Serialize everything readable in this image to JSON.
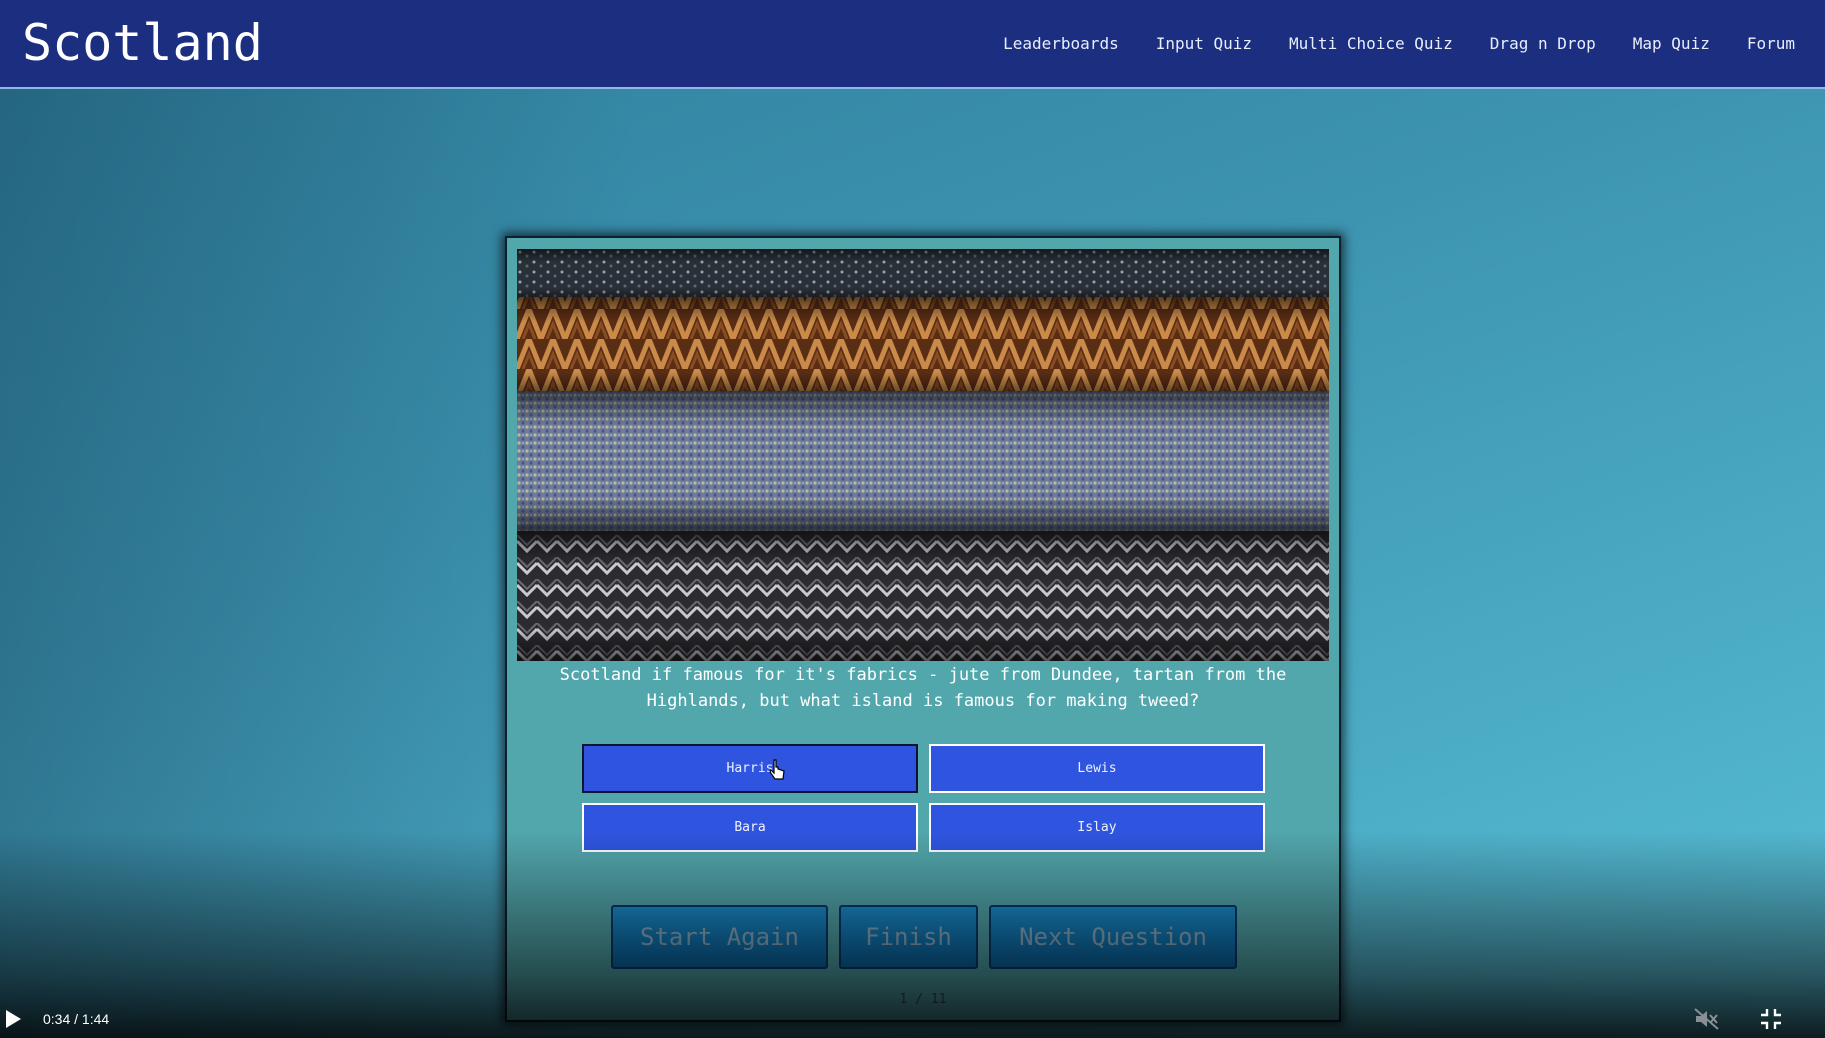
{
  "header": {
    "title": "Scotland",
    "nav": [
      "Leaderboards",
      "Input Quiz",
      "Multi Choice Quiz",
      "Drag n Drop",
      "Map Quiz",
      "Forum"
    ]
  },
  "quiz": {
    "image_alt": "stacked tweed fabrics",
    "question": "Scotland if famous for it's fabrics - jute from Dundee, tartan from the Highlands, but what island is famous for making tweed?",
    "answers": [
      "Harris",
      "Lewis",
      "Bara",
      "Islay"
    ],
    "selected_answer": "Harris",
    "controls": {
      "start_again": "Start Again",
      "finish": "Finish",
      "next_question": "Next Question"
    },
    "progress": "1 / 11"
  },
  "video": {
    "time": "0:34 / 1:44",
    "muted": true
  },
  "colors": {
    "header_bg": "#1c2e80",
    "card_bg": "#52a7ad",
    "answer_bg": "#2f55e0",
    "control_bg": "#0a7fc0"
  },
  "icons": {
    "play": "play-icon",
    "mute": "mute-icon",
    "fullscreen": "exit-fullscreen-icon",
    "cursor": "pointer-cursor-icon"
  }
}
